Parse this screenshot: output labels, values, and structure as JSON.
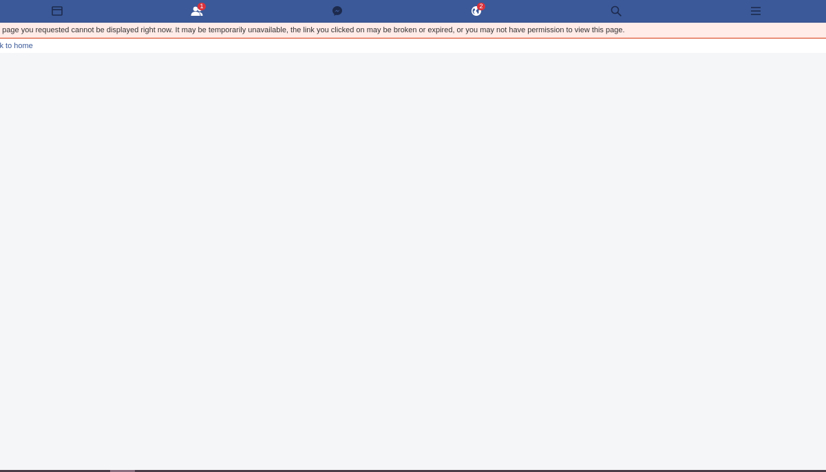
{
  "topbar": {
    "background": "#3b5998",
    "items": [
      {
        "icon": "news-feed-icon"
      },
      {
        "icon": "friend-requests-icon",
        "badge": "1"
      },
      {
        "icon": "messenger-icon"
      },
      {
        "icon": "notifications-globe-icon",
        "badge": "2"
      },
      {
        "icon": "search-icon"
      },
      {
        "icon": "menu-icon"
      }
    ]
  },
  "error": {
    "message": "e page you requested cannot be displayed right now. It may be temporarily unavailable, the link you clicked on may be broken or expired, or you may not have permission to view this page.",
    "background": "#ffebe8"
  },
  "home_link": {
    "label": "ck to home",
    "color": "#3b5998"
  },
  "page_background": "#f5f6f7"
}
